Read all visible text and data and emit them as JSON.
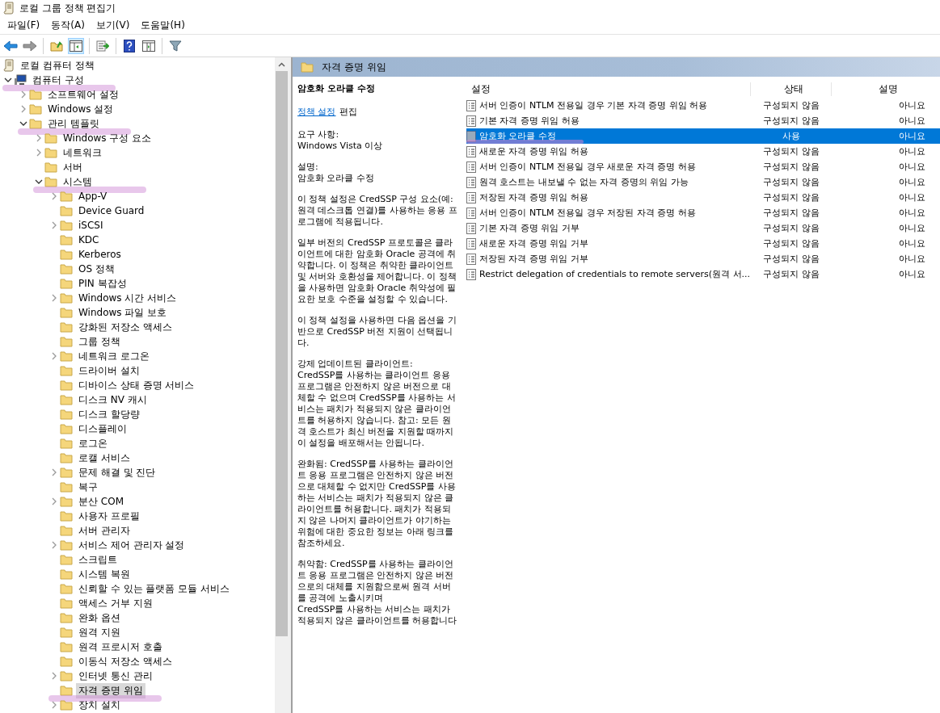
{
  "window": {
    "title": "로컬 그룹 정책 편집기"
  },
  "menu": [
    "파일(F)",
    "동작(A)",
    "보기(V)",
    "도움말(H)"
  ],
  "tree": {
    "label": "로컬 컴퓨터 정책",
    "kind": "policy",
    "selected": false,
    "children": [
      {
        "label": "컴퓨터 구성",
        "kind": "computer",
        "expanded": true,
        "selected": false,
        "marked": true,
        "children": [
          {
            "label": "소프트웨어 설정",
            "kind": "folder",
            "expanded": false,
            "selected": false
          },
          {
            "label": "Windows 설정",
            "kind": "folder",
            "expanded": false,
            "selected": false
          },
          {
            "label": "관리 템플릿",
            "kind": "folder",
            "expanded": true,
            "selected": false,
            "marked": true,
            "children": [
              {
                "label": "Windows 구성 요소",
                "kind": "folder",
                "expanded": false,
                "selected": false
              },
              {
                "label": "네트워크",
                "kind": "folder",
                "expanded": false,
                "selected": false
              },
              {
                "label": "서버",
                "kind": "folder",
                "selected": false
              },
              {
                "label": "시스템",
                "kind": "folder",
                "expanded": true,
                "selected": false,
                "marked": true,
                "children": [
                  {
                    "label": "App-V",
                    "kind": "folder",
                    "expanded": false,
                    "selected": false
                  },
                  {
                    "label": "Device Guard",
                    "kind": "folder",
                    "selected": false
                  },
                  {
                    "label": "iSCSI",
                    "kind": "folder",
                    "expanded": false,
                    "selected": false
                  },
                  {
                    "label": "KDC",
                    "kind": "folder",
                    "selected": false
                  },
                  {
                    "label": "Kerberos",
                    "kind": "folder",
                    "selected": false
                  },
                  {
                    "label": "OS 정책",
                    "kind": "folder",
                    "selected": false
                  },
                  {
                    "label": "PIN 복잡성",
                    "kind": "folder",
                    "selected": false
                  },
                  {
                    "label": "Windows 시간 서비스",
                    "kind": "folder",
                    "expanded": false,
                    "selected": false
                  },
                  {
                    "label": "Windows 파일 보호",
                    "kind": "folder",
                    "selected": false
                  },
                  {
                    "label": "강화된 저장소 액세스",
                    "kind": "folder",
                    "selected": false
                  },
                  {
                    "label": "그룹 정책",
                    "kind": "folder",
                    "selected": false
                  },
                  {
                    "label": "네트워크 로그온",
                    "kind": "folder",
                    "expanded": false,
                    "selected": false
                  },
                  {
                    "label": "드라이버 설치",
                    "kind": "folder",
                    "selected": false
                  },
                  {
                    "label": "디바이스 상태 증명 서비스",
                    "kind": "folder",
                    "selected": false
                  },
                  {
                    "label": "디스크 NV 캐시",
                    "kind": "folder",
                    "selected": false
                  },
                  {
                    "label": "디스크 할당량",
                    "kind": "folder",
                    "selected": false
                  },
                  {
                    "label": "디스플레이",
                    "kind": "folder",
                    "selected": false
                  },
                  {
                    "label": "로그온",
                    "kind": "folder",
                    "selected": false
                  },
                  {
                    "label": "로캘 서비스",
                    "kind": "folder",
                    "selected": false
                  },
                  {
                    "label": "문제 해결 및 진단",
                    "kind": "folder",
                    "expanded": false,
                    "selected": false
                  },
                  {
                    "label": "복구",
                    "kind": "folder",
                    "selected": false
                  },
                  {
                    "label": "분산 COM",
                    "kind": "folder",
                    "expanded": false,
                    "selected": false
                  },
                  {
                    "label": "사용자 프로필",
                    "kind": "folder",
                    "selected": false
                  },
                  {
                    "label": "서버 관리자",
                    "kind": "folder",
                    "selected": false
                  },
                  {
                    "label": "서비스 제어 관리자 설정",
                    "kind": "folder",
                    "expanded": false,
                    "selected": false
                  },
                  {
                    "label": "스크립트",
                    "kind": "folder",
                    "selected": false
                  },
                  {
                    "label": "시스템 복원",
                    "kind": "folder",
                    "selected": false
                  },
                  {
                    "label": "신뢰할 수 있는 플랫폼 모듈 서비스",
                    "kind": "folder",
                    "selected": false
                  },
                  {
                    "label": "액세스 거부 지원",
                    "kind": "folder",
                    "selected": false
                  },
                  {
                    "label": "완화 옵션",
                    "kind": "folder",
                    "selected": false
                  },
                  {
                    "label": "원격 지원",
                    "kind": "folder",
                    "selected": false
                  },
                  {
                    "label": "원격 프로시저 호출",
                    "kind": "folder",
                    "selected": false
                  },
                  {
                    "label": "이동식 저장소 액세스",
                    "kind": "folder",
                    "selected": false
                  },
                  {
                    "label": "인터넷 통신 관리",
                    "kind": "folder",
                    "expanded": false,
                    "selected": false
                  },
                  {
                    "label": "자격 증명 위임",
                    "kind": "folder",
                    "selected": true,
                    "marked": true
                  },
                  {
                    "label": "장치 설치",
                    "kind": "folder",
                    "expanded": false,
                    "selected": false
                  }
                ]
              }
            ]
          }
        ]
      }
    ]
  },
  "pane_title": "자격 증명 위임",
  "description": {
    "title": "암호화 오라클 수정",
    "link": "정책 설정",
    "link_suffix": "편집",
    "blocks": [
      [
        "요구 사항:",
        "Windows Vista 이상"
      ],
      [
        "설명:",
        "암호화 오라클 수정"
      ],
      [
        "이 정책 설정은 CredSSP 구성 요소(예: 원격 데스크톱 연결)를 사용하는 응용 프로그램에 적용됩니다."
      ],
      [
        "일부 버전의 CredSSP 프로토콜은 클라이언트에 대한 암호화 Oracle 공격에 취약합니다.  이 정책은 취약한 클라이언트 및 서버와 호환성을 제어합니다.  이 정책을 사용하면 암호화 Oracle 취약성에 필요한 보호 수준을 설정할 수 있습니다."
      ],
      [
        "이 정책 설정을 사용하면 다음 옵션을 기반으로 CredSSP 버전 지원이 선택됩니다."
      ],
      [
        "강제 업데이트된 클라이언트:",
        "CredSSP를 사용하는 클라이언트 응용 프로그램은 안전하지 않은 버전으로 대체할 수 없으며 CredSSP를 사용하는 서비스는 패치가 적용되지 않은 클라이언트를 허용하지 않습니다. 참고: 모든 원격 호스트가 최신 버전을 지원할 때까지 이 설정을 배포해서는 안됩니다."
      ],
      [
        "완화됨: CredSSP를 사용하는 클라이언트 응용 프로그램은 안전하지 않은 버전으로 대체할 수 없지만 CredSSP를 사용하는 서비스는 패치가 적용되지 않은 클라이언트를 허용합니다. 패치가 적용되지 않은 나머지 클라이언트가 야기하는 위험에 대한 중요한 정보는 아래 링크를 참조하세요."
      ],
      [
        "취약함: CredSSP를 사용하는 클라이언트 응용 프로그램은 안전하지 않은 버전으로의 대체를 지원함으로써 원격 서버를 공격에 노출시키며",
        "CredSSP를 사용하는 서비스는 패치가 적용되지 않은 클라이언트를 허용합니다"
      ]
    ]
  },
  "table": {
    "columns": [
      "설정",
      "상태",
      "설명"
    ],
    "rows": [
      {
        "setting": "서버 인증이 NTLM 전용일 경우 기본 자격 증명 위임 허용",
        "state": "구성되지 않음",
        "comment": "아니요",
        "selected": false
      },
      {
        "setting": "기본 자격 증명 위임 허용",
        "state": "구성되지 않음",
        "comment": "아니요",
        "selected": false
      },
      {
        "setting": "암호화 오라클 수정",
        "state": "사용",
        "comment": "아니요",
        "selected": true,
        "marked": true
      },
      {
        "setting": "새로운 자격 증명 위임 허용",
        "state": "구성되지 않음",
        "comment": "아니요",
        "selected": false
      },
      {
        "setting": "서버 인증이 NTLM 전용일 경우 새로운 자격 증명 허용",
        "state": "구성되지 않음",
        "comment": "아니요",
        "selected": false
      },
      {
        "setting": "원격 호스트는 내보낼 수 없는 자격 증명의 위임 가능",
        "state": "구성되지 않음",
        "comment": "아니요",
        "selected": false
      },
      {
        "setting": "저장된 자격 증명 위임 허용",
        "state": "구성되지 않음",
        "comment": "아니요",
        "selected": false
      },
      {
        "setting": "서버 인증이 NTLM 전용일 경우 저장된 자격 증명 허용",
        "state": "구성되지 않음",
        "comment": "아니요",
        "selected": false
      },
      {
        "setting": "기본 자격 증명 위임 거부",
        "state": "구성되지 않음",
        "comment": "아니요",
        "selected": false
      },
      {
        "setting": "새로운 자격 증명 위임 거부",
        "state": "구성되지 않음",
        "comment": "아니요",
        "selected": false
      },
      {
        "setting": "저장된 자격 증명 위임 거부",
        "state": "구성되지 않음",
        "comment": "아니요",
        "selected": false
      },
      {
        "setting": "Restrict delegation of credentials to remote servers(원격 서...",
        "state": "구성되지 않음",
        "comment": "아니요",
        "selected": false
      }
    ]
  }
}
